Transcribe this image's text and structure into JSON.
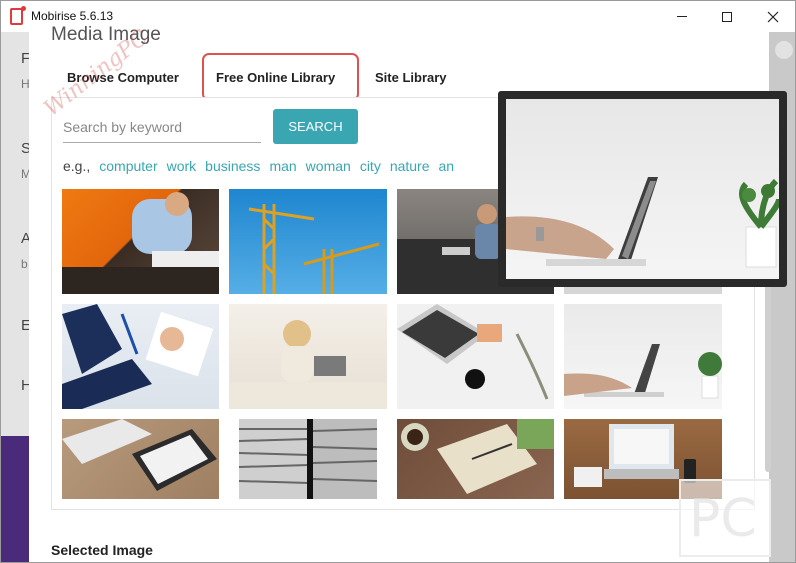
{
  "window": {
    "title": "Mobirise 5.6.13"
  },
  "background": {
    "letters": [
      "F",
      "H",
      "S",
      "M",
      "A",
      "b",
      "E",
      "H"
    ]
  },
  "modal": {
    "heading": "Media Image",
    "tabs": [
      {
        "label": "Browse Computer"
      },
      {
        "label": "Free Online Library",
        "highlighted": true
      },
      {
        "label": "Site Library"
      }
    ],
    "search": {
      "placeholder": "Search by keyword",
      "value": "",
      "button_label": "SEARCH"
    },
    "examples_prefix": "e.g.,",
    "examples": [
      "computer",
      "work",
      "business",
      "man",
      "woman",
      "city",
      "nature",
      "an"
    ],
    "selected_label": "Selected Image"
  },
  "watermark": {
    "text": "WinningPC",
    "corner_text": "PC"
  },
  "colors": {
    "accent": "#3aa6b1",
    "highlight": "#e05252",
    "overlay_border": "#2a2a2a"
  },
  "thumbnails": [
    {
      "name": "thumb-man-writing-orange"
    },
    {
      "name": "thumb-cranes-sky"
    },
    {
      "name": "thumb-man-sofa-laptop"
    },
    {
      "name": "thumb-hidden-under-zoom"
    },
    {
      "name": "thumb-business-handshake-papers"
    },
    {
      "name": "thumb-woman-bed-laptop"
    },
    {
      "name": "thumb-laptop-flatlay"
    },
    {
      "name": "thumb-hands-laptop-plant"
    },
    {
      "name": "thumb-keyboard-tablet"
    },
    {
      "name": "thumb-stacked-papers"
    },
    {
      "name": "thumb-coffee-desk"
    },
    {
      "name": "thumb-laptop-wood-desk"
    }
  ]
}
